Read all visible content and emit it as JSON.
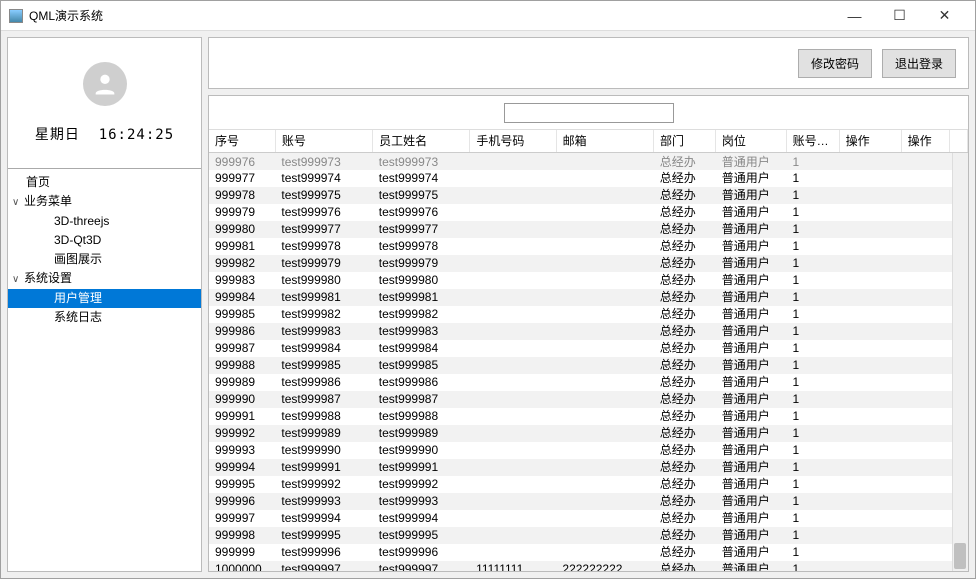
{
  "window": {
    "title": "QML演示系统"
  },
  "profile": {
    "day": "星期日",
    "time": "16:24:25"
  },
  "nav": {
    "home": "首页",
    "business": "业务菜单",
    "threejs": "3D-threejs",
    "qt3d": "3D-Qt3D",
    "drawing": "画图展示",
    "settings": "系统设置",
    "user_mgmt": "用户管理",
    "syslog": "系统日志"
  },
  "topbar": {
    "change_pw": "修改密码",
    "logout": "退出登录"
  },
  "search": {
    "value": ""
  },
  "columns": {
    "seq": "序号",
    "account": "账号",
    "name": "员工姓名",
    "mobile": "手机号码",
    "email": "邮箱",
    "dept": "部门",
    "post": "岗位",
    "status": "账号状态",
    "op1": "操作",
    "op2": "操作"
  },
  "clipped_row": {
    "seq": "999976",
    "account": "test999973",
    "name": "test999973",
    "dept": "总经办",
    "post": "普通用户",
    "status": "1"
  },
  "rows": [
    {
      "seq": "999977",
      "account": "test999974",
      "name": "test999974",
      "mobile": "",
      "email": "",
      "dept": "总经办",
      "post": "普通用户",
      "status": "1"
    },
    {
      "seq": "999978",
      "account": "test999975",
      "name": "test999975",
      "mobile": "",
      "email": "",
      "dept": "总经办",
      "post": "普通用户",
      "status": "1"
    },
    {
      "seq": "999979",
      "account": "test999976",
      "name": "test999976",
      "mobile": "",
      "email": "",
      "dept": "总经办",
      "post": "普通用户",
      "status": "1"
    },
    {
      "seq": "999980",
      "account": "test999977",
      "name": "test999977",
      "mobile": "",
      "email": "",
      "dept": "总经办",
      "post": "普通用户",
      "status": "1"
    },
    {
      "seq": "999981",
      "account": "test999978",
      "name": "test999978",
      "mobile": "",
      "email": "",
      "dept": "总经办",
      "post": "普通用户",
      "status": "1"
    },
    {
      "seq": "999982",
      "account": "test999979",
      "name": "test999979",
      "mobile": "",
      "email": "",
      "dept": "总经办",
      "post": "普通用户",
      "status": "1"
    },
    {
      "seq": "999983",
      "account": "test999980",
      "name": "test999980",
      "mobile": "",
      "email": "",
      "dept": "总经办",
      "post": "普通用户",
      "status": "1"
    },
    {
      "seq": "999984",
      "account": "test999981",
      "name": "test999981",
      "mobile": "",
      "email": "",
      "dept": "总经办",
      "post": "普通用户",
      "status": "1"
    },
    {
      "seq": "999985",
      "account": "test999982",
      "name": "test999982",
      "mobile": "",
      "email": "",
      "dept": "总经办",
      "post": "普通用户",
      "status": "1"
    },
    {
      "seq": "999986",
      "account": "test999983",
      "name": "test999983",
      "mobile": "",
      "email": "",
      "dept": "总经办",
      "post": "普通用户",
      "status": "1"
    },
    {
      "seq": "999987",
      "account": "test999984",
      "name": "test999984",
      "mobile": "",
      "email": "",
      "dept": "总经办",
      "post": "普通用户",
      "status": "1"
    },
    {
      "seq": "999988",
      "account": "test999985",
      "name": "test999985",
      "mobile": "",
      "email": "",
      "dept": "总经办",
      "post": "普通用户",
      "status": "1"
    },
    {
      "seq": "999989",
      "account": "test999986",
      "name": "test999986",
      "mobile": "",
      "email": "",
      "dept": "总经办",
      "post": "普通用户",
      "status": "1"
    },
    {
      "seq": "999990",
      "account": "test999987",
      "name": "test999987",
      "mobile": "",
      "email": "",
      "dept": "总经办",
      "post": "普通用户",
      "status": "1"
    },
    {
      "seq": "999991",
      "account": "test999988",
      "name": "test999988",
      "mobile": "",
      "email": "",
      "dept": "总经办",
      "post": "普通用户",
      "status": "1"
    },
    {
      "seq": "999992",
      "account": "test999989",
      "name": "test999989",
      "mobile": "",
      "email": "",
      "dept": "总经办",
      "post": "普通用户",
      "status": "1"
    },
    {
      "seq": "999993",
      "account": "test999990",
      "name": "test999990",
      "mobile": "",
      "email": "",
      "dept": "总经办",
      "post": "普通用户",
      "status": "1"
    },
    {
      "seq": "999994",
      "account": "test999991",
      "name": "test999991",
      "mobile": "",
      "email": "",
      "dept": "总经办",
      "post": "普通用户",
      "status": "1"
    },
    {
      "seq": "999995",
      "account": "test999992",
      "name": "test999992",
      "mobile": "",
      "email": "",
      "dept": "总经办",
      "post": "普通用户",
      "status": "1"
    },
    {
      "seq": "999996",
      "account": "test999993",
      "name": "test999993",
      "mobile": "",
      "email": "",
      "dept": "总经办",
      "post": "普通用户",
      "status": "1"
    },
    {
      "seq": "999997",
      "account": "test999994",
      "name": "test999994",
      "mobile": "",
      "email": "",
      "dept": "总经办",
      "post": "普通用户",
      "status": "1"
    },
    {
      "seq": "999998",
      "account": "test999995",
      "name": "test999995",
      "mobile": "",
      "email": "",
      "dept": "总经办",
      "post": "普通用户",
      "status": "1"
    },
    {
      "seq": "999999",
      "account": "test999996",
      "name": "test999996",
      "mobile": "",
      "email": "",
      "dept": "总经办",
      "post": "普通用户",
      "status": "1"
    },
    {
      "seq": "1000000",
      "account": "test999997",
      "name": "test999997",
      "mobile": "11111111",
      "email": "222222222",
      "dept": "总经办",
      "post": "普通用户",
      "status": "1"
    }
  ]
}
